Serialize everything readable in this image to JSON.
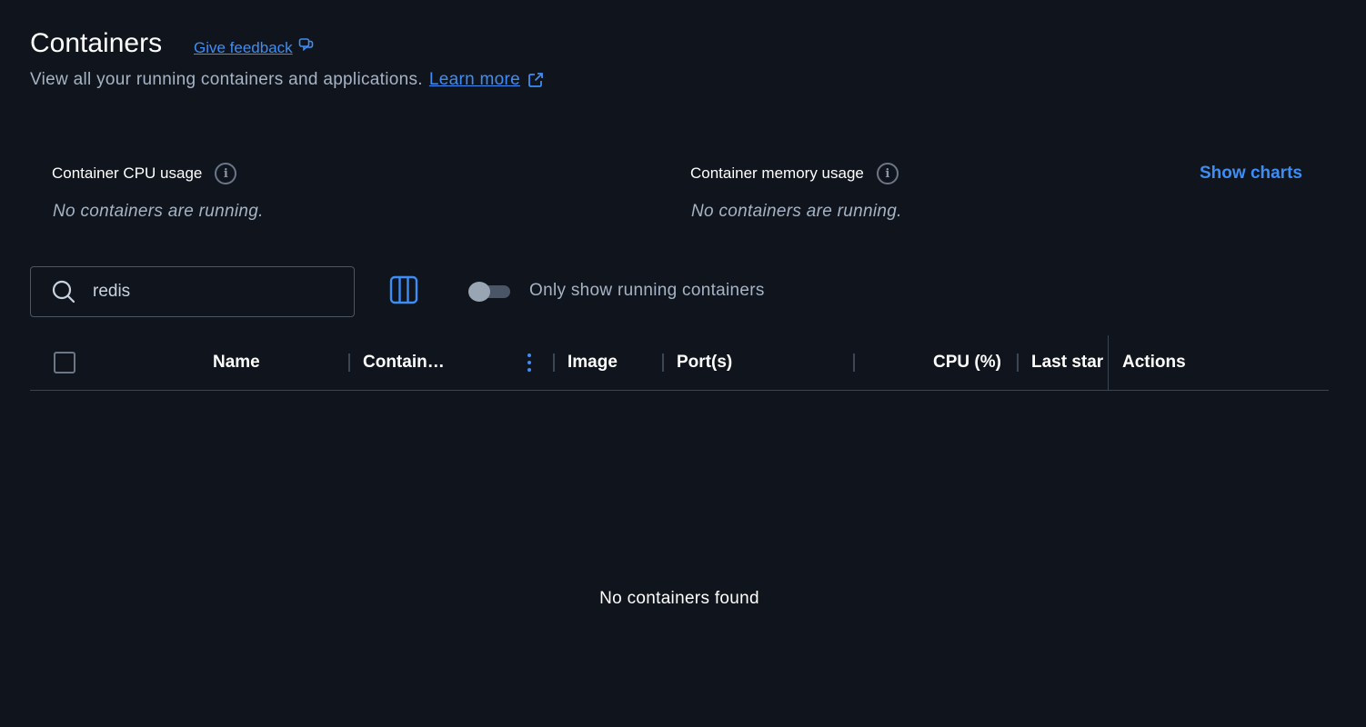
{
  "header": {
    "title": "Containers",
    "feedback_label": "Give feedback",
    "subtitle": "View all your running containers and applications.",
    "learn_more": "Learn more"
  },
  "stats": {
    "cpu_label": "Container CPU usage",
    "cpu_empty": "No containers are running.",
    "memory_label": "Container memory usage",
    "memory_empty": "No containers are running.",
    "show_charts": "Show charts"
  },
  "toolbar": {
    "search_value": "redis",
    "toggle_label": "Only show running containers",
    "toggle_on": false
  },
  "table": {
    "columns": [
      "Name",
      "Contain…",
      "Image",
      "Port(s)",
      "CPU (%)",
      "Last star",
      "Actions"
    ],
    "empty_message": "No containers found"
  },
  "colors": {
    "background": "#10151d",
    "accent": "#3d8df5",
    "muted_text": "#a6b3c4"
  }
}
